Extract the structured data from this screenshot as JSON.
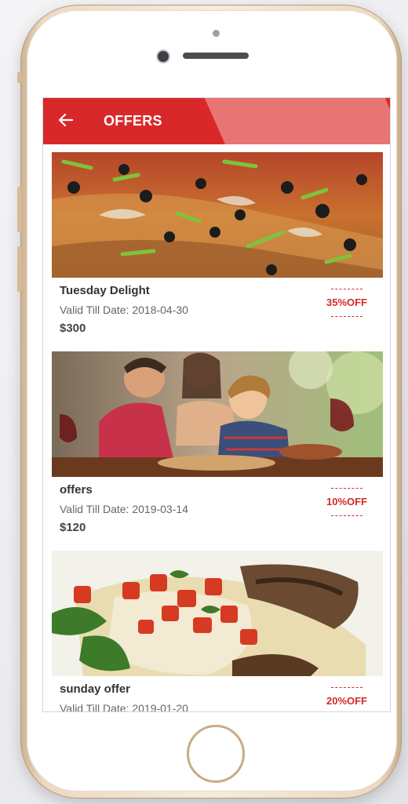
{
  "appbar": {
    "title": "OFFERS",
    "back_icon": "arrow-left-icon",
    "color": "#d9282a",
    "accent_color": "#e87474"
  },
  "offers": [
    {
      "name": "Tuesday Delight",
      "valid": "Valid Till Date: 2018-04-30",
      "price": "$300",
      "discount": "35%OFF",
      "image": "pizza-photo"
    },
    {
      "name": "offers",
      "valid": "Valid Till Date: 2019-03-14",
      "price": "$120",
      "discount": "10%OFF",
      "image": "family-dining-photo"
    },
    {
      "name": "sunday offer",
      "valid": "Valid Till Date: 2019-01-20",
      "price": "",
      "discount": "20%OFF",
      "image": "bruschetta-chicken-photo"
    }
  ]
}
